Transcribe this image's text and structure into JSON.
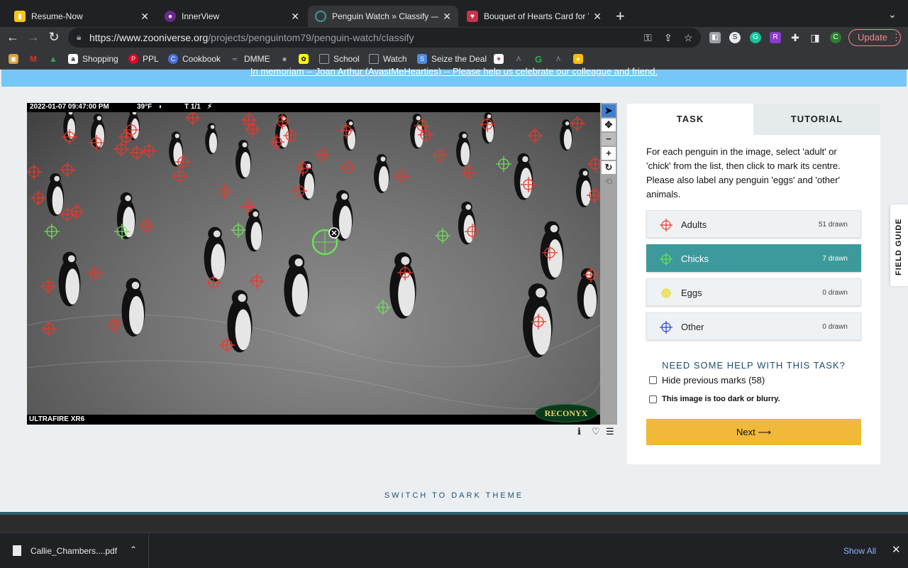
{
  "browser": {
    "tabs": [
      {
        "title": "Resume-Now",
        "icon": "resume-now-favicon",
        "color": "#f5c518",
        "close": "✕"
      },
      {
        "title": "InnerView",
        "icon": "innerview-favicon",
        "color": "#6b2a8a",
        "close": "✕"
      },
      {
        "title": "Penguin Watch » Classify — Zo",
        "icon": "zooniverse-favicon",
        "color": "#3d9a9c",
        "close": "✕"
      },
      {
        "title": "Bouquet of Hearts Card for Val",
        "icon": "card-favicon",
        "color": "#c8324a",
        "close": "✕"
      }
    ],
    "new_tab": "+",
    "tab_menu": "⌄",
    "url_domain": "https://www.zooniverse.org",
    "url_path": "/projects/penguintom79/penguin-watch/classify",
    "update_label": "Update",
    "profile_initial": "C",
    "bookmarks": [
      {
        "label": "",
        "icon": "image-icon",
        "color": "#d8a33a"
      },
      {
        "label": "",
        "icon": "gmail-icon",
        "color": "#d93025"
      },
      {
        "label": "",
        "icon": "drive-icon",
        "color": "#188038"
      },
      {
        "label": "Shopping",
        "icon": "amazon-icon",
        "color": "#ffffff"
      },
      {
        "label": "PPL",
        "icon": "pinterest-icon",
        "color": "#e60023"
      },
      {
        "label": "Cookbook",
        "icon": "cookbook-icon",
        "color": "#4a6ee0"
      },
      {
        "label": "DMME",
        "icon": "dmme-icon",
        "color": "#5f6368"
      },
      {
        "label": "",
        "icon": "apple-icon",
        "color": "#9aa0a6"
      },
      {
        "label": "",
        "icon": "snapchat-icon",
        "color": "#fffc00"
      },
      {
        "label": "School",
        "icon": "folder-icon",
        "color": "#9aa0a6"
      },
      {
        "label": "Watch",
        "icon": "folder-icon",
        "color": "#9aa0a6"
      },
      {
        "label": "Seize the Deal",
        "icon": "seize-icon",
        "color": "#4a8ee0"
      }
    ]
  },
  "page": {
    "banner": "In memoriam -- Joan Arthur (AvastMeHearties) -- Please help us celebrate our colleague and friend.",
    "camera": {
      "timestamp": "2022-01-07 09:47:00 PM",
      "temperature": "39°F",
      "frame": "T 1/1",
      "model": "ULTRAFIRE XR6",
      "brand": "RECONYX"
    },
    "viewer_tools": [
      {
        "name": "pointer-tool",
        "glyph": "➤"
      },
      {
        "name": "move-tool",
        "glyph": "✥"
      },
      {
        "name": "zoom-out-tool",
        "glyph": "−"
      },
      {
        "name": "zoom-in-tool",
        "glyph": "+"
      },
      {
        "name": "rotate-tool",
        "glyph": "↻"
      },
      {
        "name": "reset-tool",
        "glyph": "⟲"
      }
    ],
    "viewer_footer": {
      "info": "ℹ",
      "favorite": "♡",
      "collections": "☰"
    },
    "panel": {
      "tab_task": "TASK",
      "tab_tutorial": "TUTORIAL",
      "instructions": "For each penguin in the image, select 'adult' or 'chick' from the list, then click to mark its centre. Please also label any penguin 'eggs' and 'other' animals.",
      "tools": [
        {
          "label": "Adults",
          "count": "51 drawn",
          "color": "#e8392b"
        },
        {
          "label": "Chicks",
          "count": "7 drawn",
          "color": "#6ee05a"
        },
        {
          "label": "Eggs",
          "count": "0 drawn",
          "color": "#e8e23a"
        },
        {
          "label": "Other",
          "count": "0 drawn",
          "color": "#2a3fd8"
        }
      ],
      "help": "NEED SOME HELP WITH THIS TASK?",
      "hide_marks": "Hide previous marks (58)",
      "too_dark": "This image is too dark or blurry.",
      "next": "Next ⟶"
    },
    "field_guide": "FIELD GUIDE",
    "dark_theme": "SWITCH TO DARK THEME"
  },
  "downloads": {
    "file": "Callie_Chambers....pdf",
    "show_all": "Show All"
  }
}
